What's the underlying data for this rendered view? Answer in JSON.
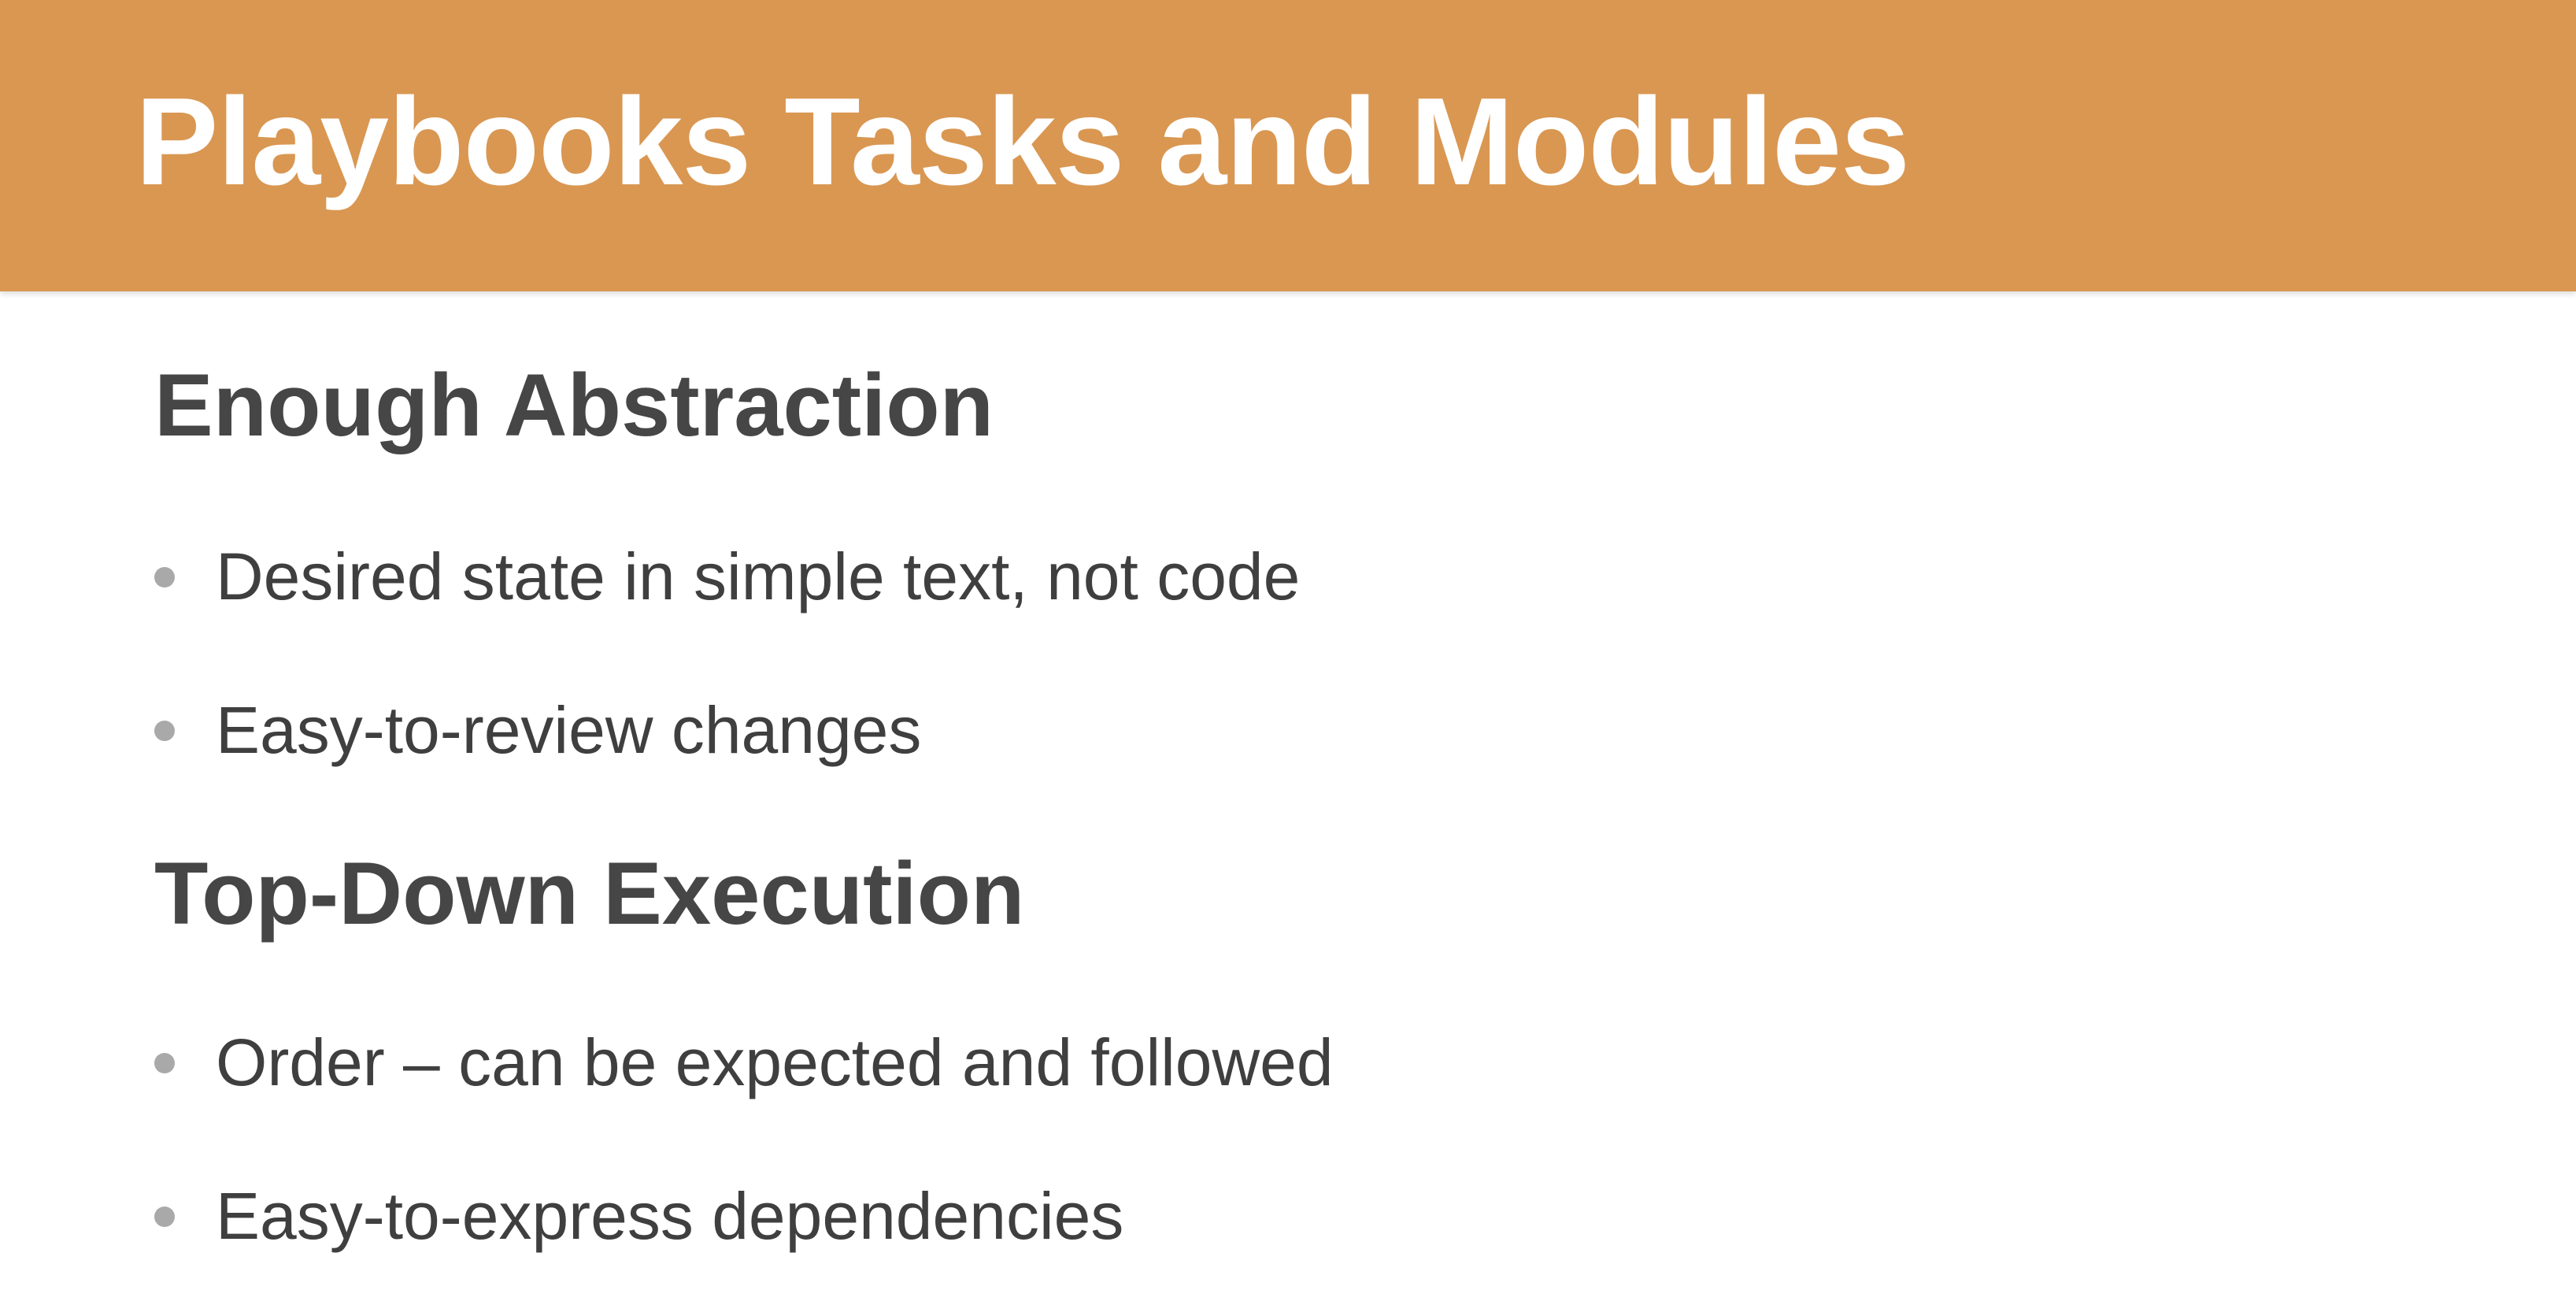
{
  "slide": {
    "title": "Playbooks Tasks and Modules",
    "accent_color": "#d99752",
    "sections": [
      {
        "heading": "Enough Abstraction",
        "bullets": [
          "Desired state in simple text, not code",
          "Easy-to-review changes"
        ]
      },
      {
        "heading": "Top-Down Execution",
        "bullets": [
          "Order – can be expected and followed",
          "Easy-to-express dependencies"
        ]
      }
    ]
  }
}
